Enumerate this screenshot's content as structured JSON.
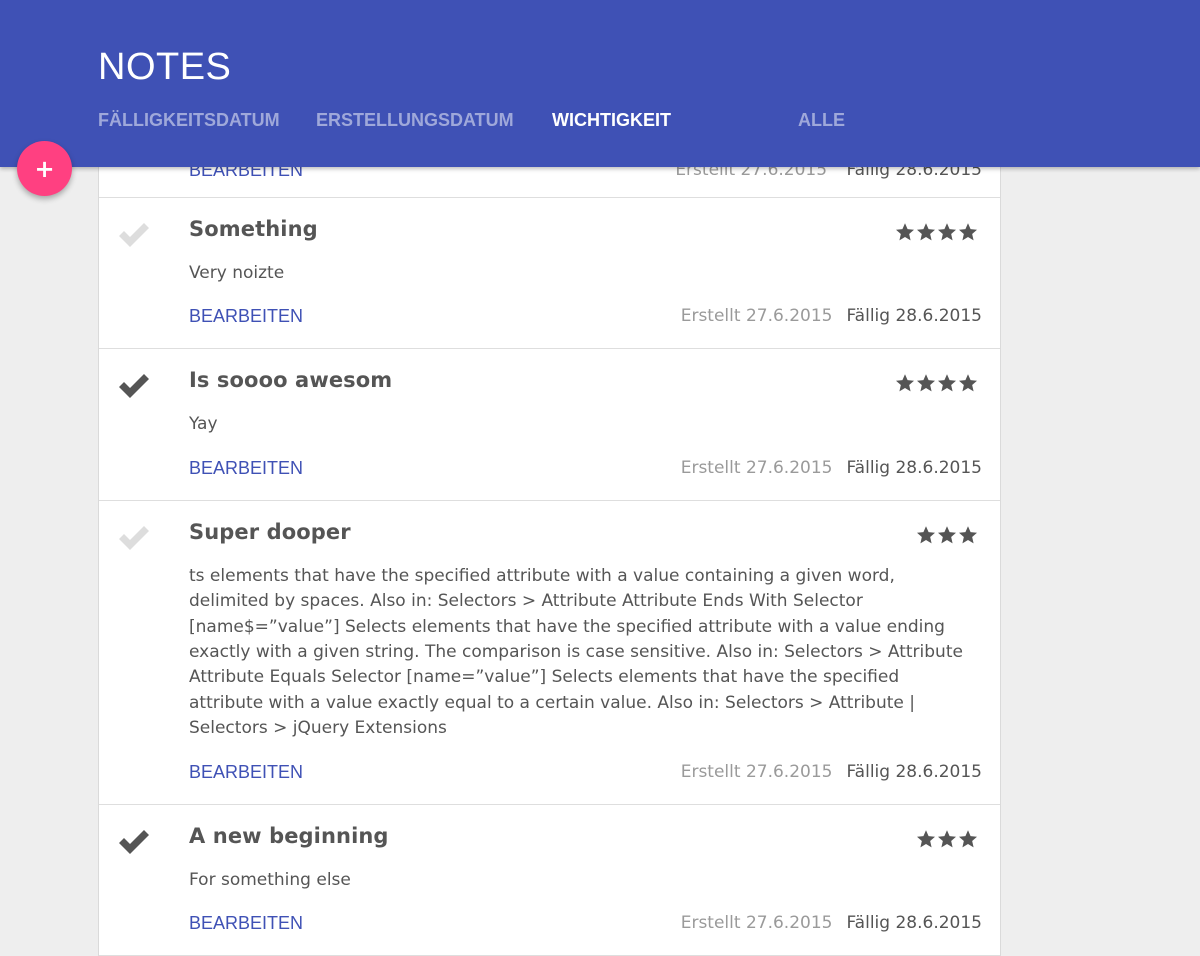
{
  "app": {
    "title": "NOTES"
  },
  "tabs": [
    {
      "label": "FÄLLIGKEITSDATUM",
      "active": false
    },
    {
      "label": "ERSTELLUNGSDATUM",
      "active": false
    },
    {
      "label": "WICHTIGKEIT",
      "active": true
    },
    {
      "label": "ALLE",
      "active": false
    }
  ],
  "fab": {
    "label": "+"
  },
  "colors": {
    "primary": "#3f51b5",
    "accent": "#ff4081",
    "check_done": "#555555",
    "check_open": "#dddddd",
    "star": "#555555"
  },
  "partial_note": {
    "edit_label": "BEARBEITEN",
    "created": "Erstellt 27.6.2015",
    "due": "Fällig 28.6.2015"
  },
  "notes": [
    {
      "title": "Something",
      "description": "Very noizte",
      "done": false,
      "rating": 4,
      "edit_label": "BEARBEITEN",
      "created": "Erstellt 27.6.2015",
      "due": "Fällig 28.6.2015"
    },
    {
      "title": "Is soooo awesom",
      "description": "Yay",
      "done": true,
      "rating": 4,
      "edit_label": "BEARBEITEN",
      "created": "Erstellt 27.6.2015",
      "due": "Fällig 28.6.2015"
    },
    {
      "title": "Super dooper",
      "description": "ts elements that have the specified attribute with a value containing a given word, delimited by spaces. Also in: Selectors > Attribute Attribute Ends With Selector [name$=”value”] Selects elements that have the specified attribute with a value ending exactly with a given string. The comparison is case sensitive. Also in: Selectors > Attribute Attribute Equals Selector [name=”value”] Selects elements that have the specified attribute with a value exactly equal to a certain value. Also in: Selectors > Attribute | Selectors > jQuery Extensions",
      "done": false,
      "rating": 3,
      "edit_label": "BEARBEITEN",
      "created": "Erstellt 27.6.2015",
      "due": "Fällig 28.6.2015"
    },
    {
      "title": "A new beginning",
      "description": "For something else",
      "done": true,
      "rating": 3,
      "edit_label": "BEARBEITEN",
      "created": "Erstellt 27.6.2015",
      "due": "Fällig 28.6.2015"
    }
  ]
}
